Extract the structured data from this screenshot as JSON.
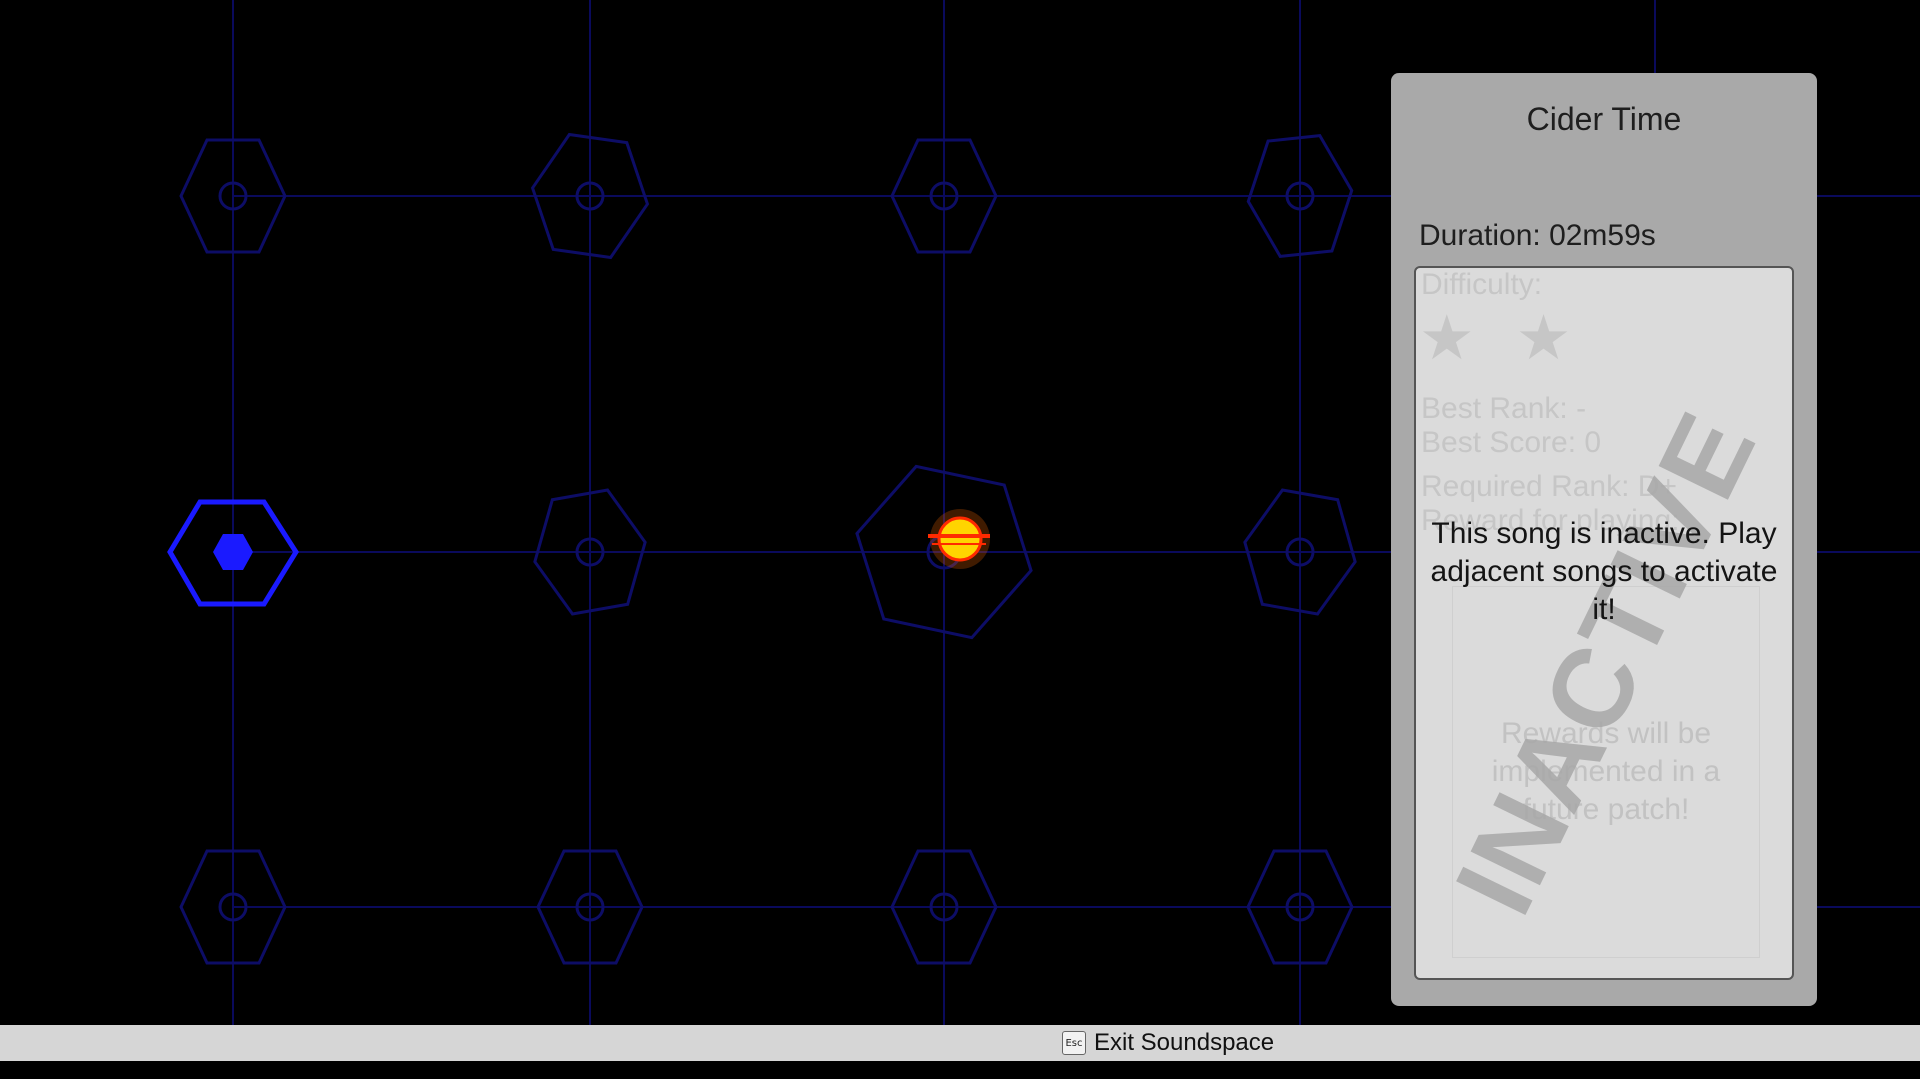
{
  "song_panel": {
    "title": "Cider Time",
    "duration": "Duration: 02m59s",
    "difficulty_label": "Difficulty:",
    "stars": "★ ★",
    "best_rank": "Best Rank: -",
    "best_score": "Best Score: 0",
    "required_rank": "Required Rank: D+",
    "reward_for": "Reward for playing:",
    "rewards_note": "Rewards will be implemented in a future patch!",
    "watermark": "INACTIVE",
    "inactive_message": "This song is inactive. Play adjacent songs to activate it!"
  },
  "bottom_bar": {
    "esc_key": "Esc",
    "exit_label": "Exit Soundspace"
  },
  "colors": {
    "grid_line": "#0a0a5c",
    "node_inactive": "#0d0d66",
    "node_active": "#1a1aff",
    "player": "#ffd400"
  },
  "icons": {
    "player_marker": "player-orb-icon",
    "active_node": "active-hex-node-icon"
  }
}
